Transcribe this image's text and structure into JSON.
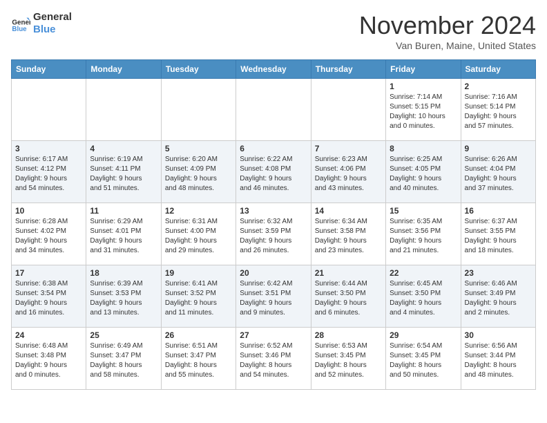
{
  "header": {
    "logo_line1": "General",
    "logo_line2": "Blue",
    "month": "November 2024",
    "location": "Van Buren, Maine, United States"
  },
  "weekdays": [
    "Sunday",
    "Monday",
    "Tuesday",
    "Wednesday",
    "Thursday",
    "Friday",
    "Saturday"
  ],
  "weeks": [
    [
      {
        "day": "",
        "info": ""
      },
      {
        "day": "",
        "info": ""
      },
      {
        "day": "",
        "info": ""
      },
      {
        "day": "",
        "info": ""
      },
      {
        "day": "",
        "info": ""
      },
      {
        "day": "1",
        "info": "Sunrise: 7:14 AM\nSunset: 5:15 PM\nDaylight: 10 hours\nand 0 minutes."
      },
      {
        "day": "2",
        "info": "Sunrise: 7:16 AM\nSunset: 5:14 PM\nDaylight: 9 hours\nand 57 minutes."
      }
    ],
    [
      {
        "day": "3",
        "info": "Sunrise: 6:17 AM\nSunset: 4:12 PM\nDaylight: 9 hours\nand 54 minutes."
      },
      {
        "day": "4",
        "info": "Sunrise: 6:19 AM\nSunset: 4:11 PM\nDaylight: 9 hours\nand 51 minutes."
      },
      {
        "day": "5",
        "info": "Sunrise: 6:20 AM\nSunset: 4:09 PM\nDaylight: 9 hours\nand 48 minutes."
      },
      {
        "day": "6",
        "info": "Sunrise: 6:22 AM\nSunset: 4:08 PM\nDaylight: 9 hours\nand 46 minutes."
      },
      {
        "day": "7",
        "info": "Sunrise: 6:23 AM\nSunset: 4:06 PM\nDaylight: 9 hours\nand 43 minutes."
      },
      {
        "day": "8",
        "info": "Sunrise: 6:25 AM\nSunset: 4:05 PM\nDaylight: 9 hours\nand 40 minutes."
      },
      {
        "day": "9",
        "info": "Sunrise: 6:26 AM\nSunset: 4:04 PM\nDaylight: 9 hours\nand 37 minutes."
      }
    ],
    [
      {
        "day": "10",
        "info": "Sunrise: 6:28 AM\nSunset: 4:02 PM\nDaylight: 9 hours\nand 34 minutes."
      },
      {
        "day": "11",
        "info": "Sunrise: 6:29 AM\nSunset: 4:01 PM\nDaylight: 9 hours\nand 31 minutes."
      },
      {
        "day": "12",
        "info": "Sunrise: 6:31 AM\nSunset: 4:00 PM\nDaylight: 9 hours\nand 29 minutes."
      },
      {
        "day": "13",
        "info": "Sunrise: 6:32 AM\nSunset: 3:59 PM\nDaylight: 9 hours\nand 26 minutes."
      },
      {
        "day": "14",
        "info": "Sunrise: 6:34 AM\nSunset: 3:58 PM\nDaylight: 9 hours\nand 23 minutes."
      },
      {
        "day": "15",
        "info": "Sunrise: 6:35 AM\nSunset: 3:56 PM\nDaylight: 9 hours\nand 21 minutes."
      },
      {
        "day": "16",
        "info": "Sunrise: 6:37 AM\nSunset: 3:55 PM\nDaylight: 9 hours\nand 18 minutes."
      }
    ],
    [
      {
        "day": "17",
        "info": "Sunrise: 6:38 AM\nSunset: 3:54 PM\nDaylight: 9 hours\nand 16 minutes."
      },
      {
        "day": "18",
        "info": "Sunrise: 6:39 AM\nSunset: 3:53 PM\nDaylight: 9 hours\nand 13 minutes."
      },
      {
        "day": "19",
        "info": "Sunrise: 6:41 AM\nSunset: 3:52 PM\nDaylight: 9 hours\nand 11 minutes."
      },
      {
        "day": "20",
        "info": "Sunrise: 6:42 AM\nSunset: 3:51 PM\nDaylight: 9 hours\nand 9 minutes."
      },
      {
        "day": "21",
        "info": "Sunrise: 6:44 AM\nSunset: 3:50 PM\nDaylight: 9 hours\nand 6 minutes."
      },
      {
        "day": "22",
        "info": "Sunrise: 6:45 AM\nSunset: 3:50 PM\nDaylight: 9 hours\nand 4 minutes."
      },
      {
        "day": "23",
        "info": "Sunrise: 6:46 AM\nSunset: 3:49 PM\nDaylight: 9 hours\nand 2 minutes."
      }
    ],
    [
      {
        "day": "24",
        "info": "Sunrise: 6:48 AM\nSunset: 3:48 PM\nDaylight: 9 hours\nand 0 minutes."
      },
      {
        "day": "25",
        "info": "Sunrise: 6:49 AM\nSunset: 3:47 PM\nDaylight: 8 hours\nand 58 minutes."
      },
      {
        "day": "26",
        "info": "Sunrise: 6:51 AM\nSunset: 3:47 PM\nDaylight: 8 hours\nand 55 minutes."
      },
      {
        "day": "27",
        "info": "Sunrise: 6:52 AM\nSunset: 3:46 PM\nDaylight: 8 hours\nand 54 minutes."
      },
      {
        "day": "28",
        "info": "Sunrise: 6:53 AM\nSunset: 3:45 PM\nDaylight: 8 hours\nand 52 minutes."
      },
      {
        "day": "29",
        "info": "Sunrise: 6:54 AM\nSunset: 3:45 PM\nDaylight: 8 hours\nand 50 minutes."
      },
      {
        "day": "30",
        "info": "Sunrise: 6:56 AM\nSunset: 3:44 PM\nDaylight: 8 hours\nand 48 minutes."
      }
    ]
  ]
}
